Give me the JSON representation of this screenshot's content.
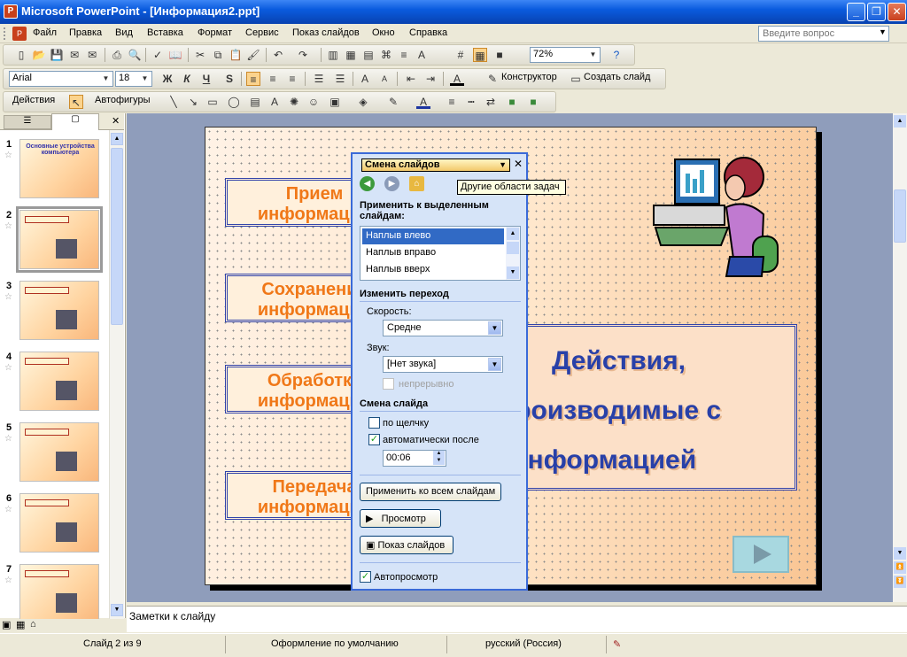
{
  "window": {
    "title": "Microsoft PowerPoint - [Информация2.ppt]",
    "controls": [
      "_",
      "❐",
      "✕"
    ]
  },
  "menu": [
    "Файл",
    "Правка",
    "Вид",
    "Вставка",
    "Формат",
    "Сервис",
    "Показ слайдов",
    "Окно",
    "Справка"
  ],
  "help_placeholder": "Введите вопрос",
  "toolbar_standard": {
    "zoom": "72%"
  },
  "toolbar_format": {
    "font": "Arial",
    "size": "18",
    "bold": "Ж",
    "italic": "К",
    "underline": "Ч",
    "shadow": "S",
    "designer": "Конструктор",
    "new_slide": "Создать слайд"
  },
  "toolbar_drawing": {
    "actions": "Действия",
    "autoshapes": "Автофигуры"
  },
  "slide_panel": {
    "thumbnails": [
      {
        "num": "1",
        "title": "Основные устройства компьютера"
      },
      {
        "num": "2",
        "title": ""
      },
      {
        "num": "3",
        "title": ""
      },
      {
        "num": "4",
        "title": ""
      },
      {
        "num": "5",
        "title": ""
      },
      {
        "num": "6",
        "title": ""
      },
      {
        "num": "7",
        "title": ""
      }
    ]
  },
  "slide": {
    "boxes": [
      {
        "line1": "Прием",
        "line2": "информации"
      },
      {
        "line1": "Сохранение",
        "line2": "информации"
      },
      {
        "line1": "Обработка",
        "line2": "информации"
      },
      {
        "line1": "Передача",
        "line2": "информации"
      }
    ],
    "main_text": [
      "Действия,",
      "производимые с",
      "информацией"
    ]
  },
  "task_pane": {
    "title": "Смена слайдов",
    "tooltip": "Другие области задач",
    "apply_label": "Применить к выделенным слайдам:",
    "transitions": [
      "Наплыв влево",
      "Наплыв вправо",
      "Наплыв вверх"
    ],
    "change_transition": "Изменить переход",
    "speed_label": "Скорость:",
    "speed_value": "Средне",
    "sound_label": "Звук:",
    "sound_value": "[Нет звука]",
    "loop_label": "непрерывно",
    "advance_label": "Смена слайда",
    "on_click": "по щелчку",
    "auto_after": "автоматически после",
    "time_value": "00:06",
    "apply_all": "Применить ко всем слайдам",
    "preview": "Просмотр",
    "slideshow": "Показ слайдов",
    "autopreview": "Автопросмотр"
  },
  "notes_placeholder": "Заметки к слайду",
  "status": {
    "slide": "Слайд 2 из 9",
    "design": "Оформление по умолчанию",
    "language": "русский (Россия)"
  }
}
